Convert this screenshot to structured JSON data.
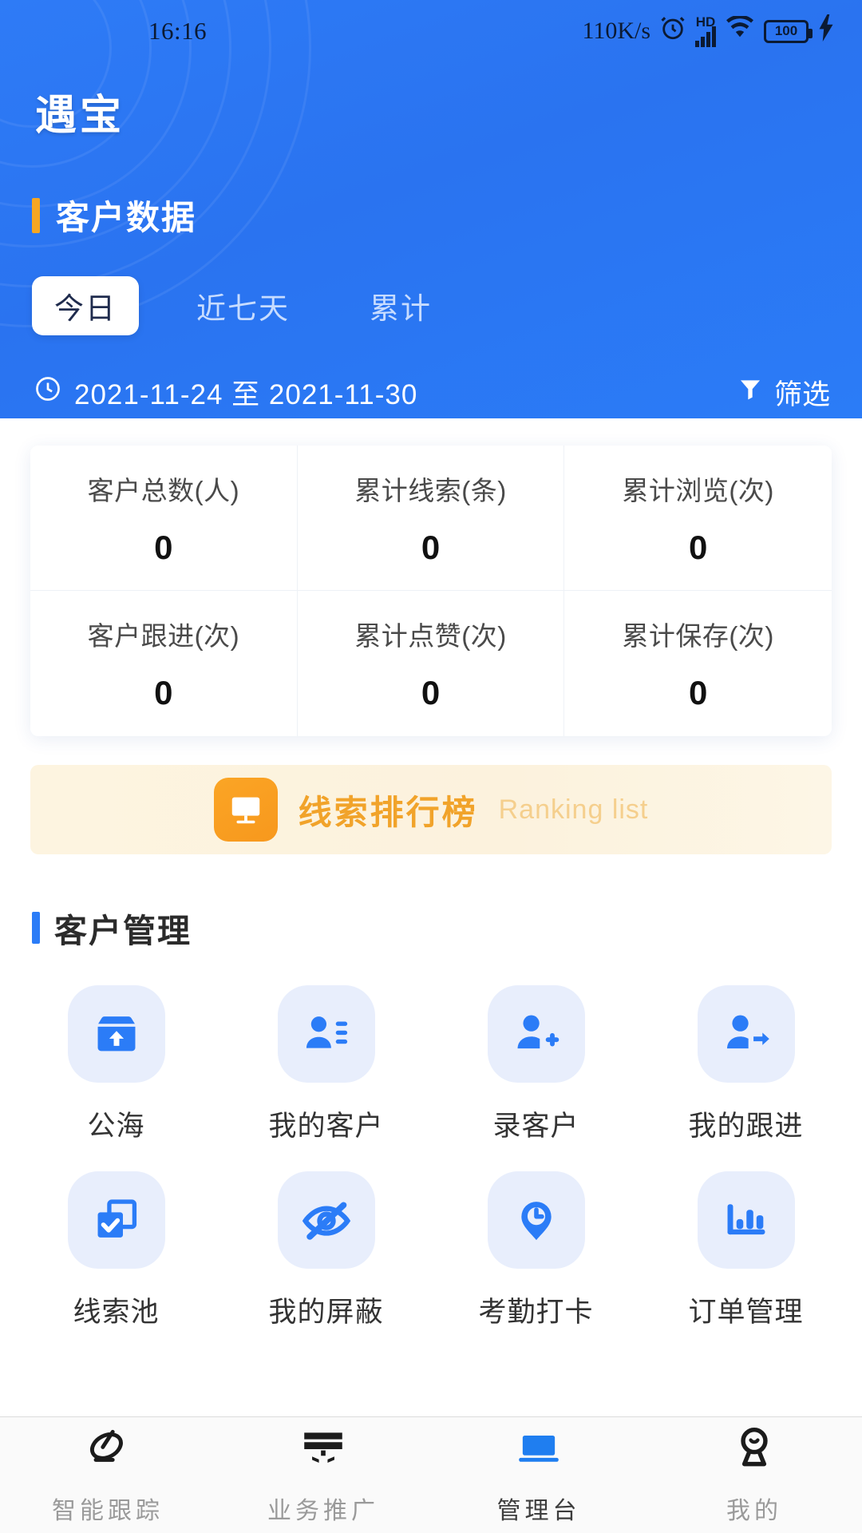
{
  "statusbar": {
    "time": "16:16",
    "network_speed": "110K/s",
    "alarm_icon": "alarm-clock-icon",
    "hd_label": "HD",
    "signal_icon": "cellular-signal-icon",
    "wifi_icon": "wifi-icon",
    "battery_level": "100",
    "charging_icon": "charging-bolt-icon"
  },
  "header": {
    "brand": "遇宝",
    "section_title": "客户数据",
    "accent_orange": "#f5a623",
    "background": "#2b7cf7",
    "tabs": [
      {
        "label": "今日",
        "active": true
      },
      {
        "label": "近七天",
        "active": false
      },
      {
        "label": "累计",
        "active": false
      }
    ],
    "date_range": {
      "icon": "clock-icon",
      "text": "2021-11-24 至 2021-11-30"
    },
    "filter": {
      "icon": "funnel-icon",
      "label": "筛选"
    }
  },
  "stats": [
    {
      "label": "客户总数(人)",
      "value": "0"
    },
    {
      "label": "累计线索(条)",
      "value": "0"
    },
    {
      "label": "累计浏览(次)",
      "value": "0"
    },
    {
      "label": "客户跟进(次)",
      "value": "0"
    },
    {
      "label": "累计点赞(次)",
      "value": "0"
    },
    {
      "label": "累计保存(次)",
      "value": "0"
    }
  ],
  "ranking_banner": {
    "icon": "whiteboard-icon",
    "title": "线索排行榜",
    "subtitle": "Ranking list",
    "accent": "#f1a32a"
  },
  "customer_management": {
    "section_title": "客户管理",
    "accent_blue": "#2b7cf7",
    "items": [
      {
        "label": "公海",
        "icon": "box-upload-icon"
      },
      {
        "label": "我的客户",
        "icon": "person-list-icon"
      },
      {
        "label": "录客户",
        "icon": "person-add-icon"
      },
      {
        "label": "我的跟进",
        "icon": "person-arrow-icon"
      },
      {
        "label": "线索池",
        "icon": "copy-check-icon"
      },
      {
        "label": "我的屏蔽",
        "icon": "eye-off-icon"
      },
      {
        "label": "考勤打卡",
        "icon": "clock-pin-icon"
      },
      {
        "label": "订单管理",
        "icon": "bar-chart-icon"
      }
    ]
  },
  "tabbar": {
    "items": [
      {
        "label": "智能跟踪",
        "icon": "radar-icon",
        "active": false
      },
      {
        "label": "业务推广",
        "icon": "monitor-icon",
        "active": false
      },
      {
        "label": "管理台",
        "icon": "laptop-icon",
        "active": true
      },
      {
        "label": "我的",
        "icon": "avatar-icon",
        "active": false
      }
    ]
  }
}
